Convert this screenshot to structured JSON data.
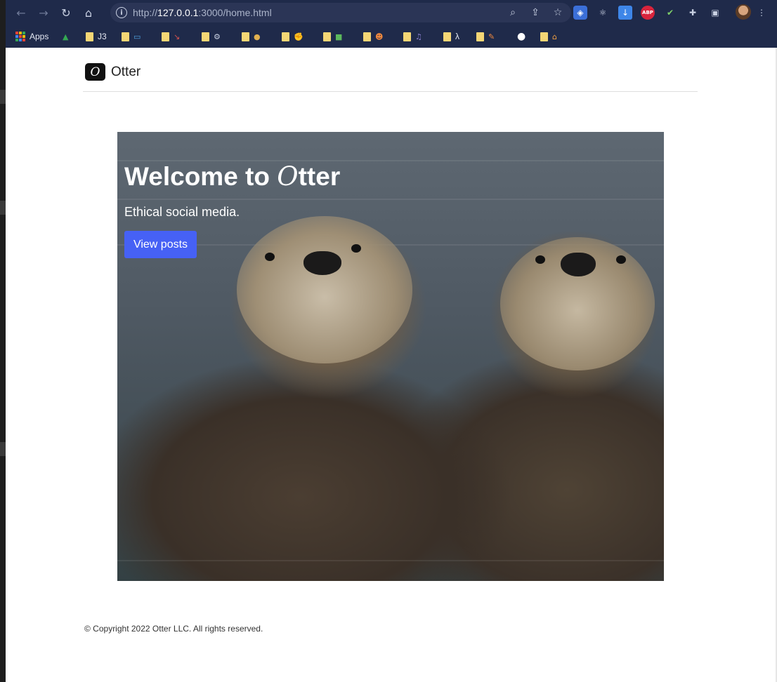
{
  "browser": {
    "url_host": "127.0.0.1",
    "url_rest": ":3000/home.html",
    "url_prefix": "http://",
    "bookmarks": {
      "apps_label": "Apps",
      "j3_label": "J3",
      "lambda_label": "λ"
    }
  },
  "site": {
    "logo_glyph": "O",
    "brand": "Otter"
  },
  "hero": {
    "title_prefix": "Welcome to ",
    "title_o": "O",
    "title_suffix": "tter",
    "subtitle": "Ethical social media.",
    "button_label": "View posts"
  },
  "footer": {
    "copyright": "© Copyright 2022 Otter LLC. All rights reserved."
  },
  "colors": {
    "chrome_bg": "#1f2a4a",
    "accent_button": "#4661f5",
    "folder": "#f5d675"
  }
}
